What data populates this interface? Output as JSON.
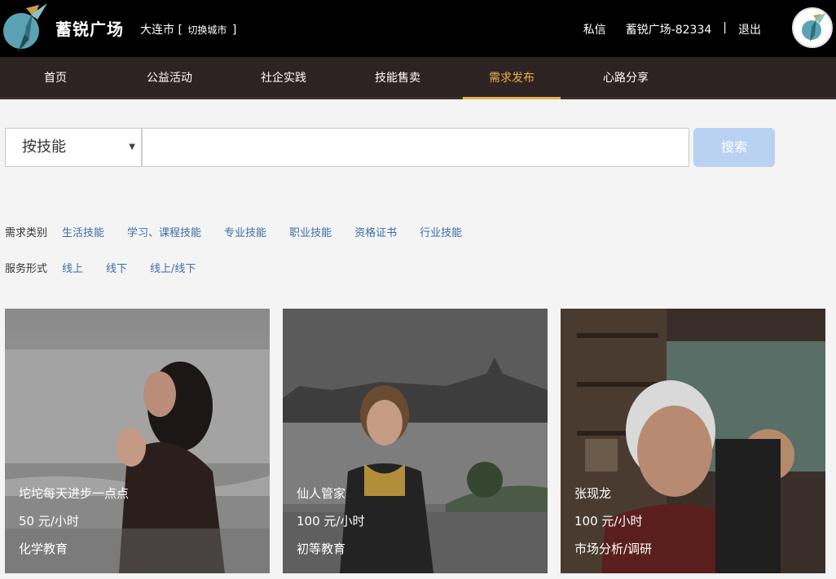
{
  "header": {
    "brand": "蓄锐广场",
    "city": "大连市",
    "city_switch_open": "[",
    "city_switch_label": "切换城市",
    "city_switch_close": "]",
    "messages": "私信",
    "username": "蓄锐广场-82334",
    "separator": "|",
    "logout": "退出",
    "logo_icon": "hummingbird-logo-icon",
    "avatar_icon": "hummingbird-avatar-icon"
  },
  "nav": {
    "items": [
      {
        "label": "首页"
      },
      {
        "label": "公益活动"
      },
      {
        "label": "社企实践"
      },
      {
        "label": "技能售卖"
      },
      {
        "label": "需求发布"
      },
      {
        "label": "心路分享"
      }
    ],
    "active_index": 4,
    "active_color": "#e8b14a"
  },
  "search": {
    "select_value": "按技能",
    "input_value": "",
    "button_label": "搜索"
  },
  "filters": {
    "category_label": "需求类别",
    "categories": [
      "生活技能",
      "学习、课程技能",
      "专业技能",
      "职业技能",
      "资格证书",
      "行业技能"
    ],
    "service_label": "服务形式",
    "services": [
      "线上",
      "线下",
      "线上/线下"
    ]
  },
  "cards": [
    {
      "name": "坨坨每天进步一点点",
      "price": "50 元/小时",
      "category": "化学教育"
    },
    {
      "name": "仙人管家",
      "price": "100 元/小时",
      "category": "初等教育"
    },
    {
      "name": "张现龙",
      "price": "100 元/小时",
      "category": "市场分析/调研"
    }
  ]
}
